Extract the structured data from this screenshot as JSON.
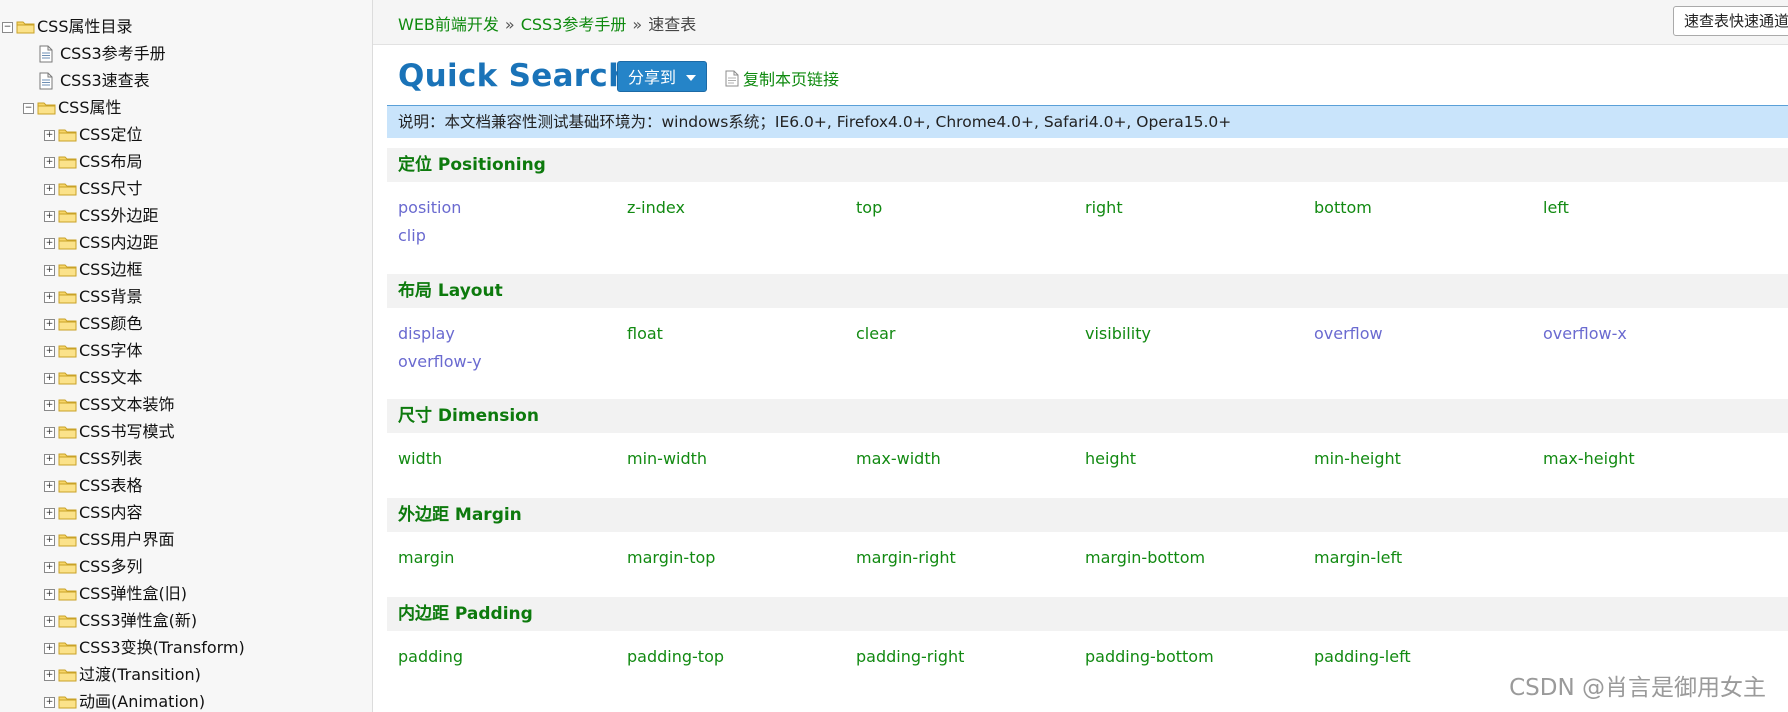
{
  "tree": {
    "root": "CSS属性目录",
    "docs": [
      "CSS3参考手册",
      "CSS3速查表"
    ],
    "group": "CSS属性",
    "children": [
      "CSS定位",
      "CSS布局",
      "CSS尺寸",
      "CSS外边距",
      "CSS内边距",
      "CSS边框",
      "CSS背景",
      "CSS颜色",
      "CSS字体",
      "CSS文本",
      "CSS文本装饰",
      "CSS书写模式",
      "CSS列表",
      "CSS表格",
      "CSS内容",
      "CSS用户界面",
      "CSS多列",
      "CSS弹性盒(旧)",
      "CSS3弹性盒(新)",
      "CSS3变换(Transform)",
      "过渡(Transition)",
      "动画(Animation)"
    ]
  },
  "breadcrumb": {
    "items": [
      "WEB前端开发",
      "CSS3参考手册",
      "速查表"
    ],
    "separator": "»"
  },
  "quick_access": "速查表快速通道",
  "page_title": "Quick Search",
  "share_label": "分享到",
  "copy_link_label": "复制本页链接",
  "notice": "说明：本文档兼容性测试基础环境为：windows系统；IE6.0+, Firefox4.0+, Chrome4.0+, Safari4.0+, Opera15.0+",
  "sections": [
    {
      "title": "定位 Positioning",
      "props": [
        {
          "name": "position",
          "color": "purple"
        },
        {
          "name": "z-index",
          "color": "green"
        },
        {
          "name": "top",
          "color": "green"
        },
        {
          "name": "right",
          "color": "green"
        },
        {
          "name": "bottom",
          "color": "green"
        },
        {
          "name": "left",
          "color": "green"
        },
        {
          "name": "clip",
          "color": "purple"
        }
      ]
    },
    {
      "title": "布局 Layout",
      "props": [
        {
          "name": "display",
          "color": "purple"
        },
        {
          "name": "float",
          "color": "green"
        },
        {
          "name": "clear",
          "color": "green"
        },
        {
          "name": "visibility",
          "color": "green"
        },
        {
          "name": "overflow",
          "color": "purple"
        },
        {
          "name": "overflow-x",
          "color": "purple"
        },
        {
          "name": "overflow-y",
          "color": "purple"
        }
      ]
    },
    {
      "title": "尺寸 Dimension",
      "props": [
        {
          "name": "width",
          "color": "green"
        },
        {
          "name": "min-width",
          "color": "green"
        },
        {
          "name": "max-width",
          "color": "green"
        },
        {
          "name": "height",
          "color": "green"
        },
        {
          "name": "min-height",
          "color": "green"
        },
        {
          "name": "max-height",
          "color": "green"
        }
      ]
    },
    {
      "title": "外边距 Margin",
      "props": [
        {
          "name": "margin",
          "color": "green"
        },
        {
          "name": "margin-top",
          "color": "green"
        },
        {
          "name": "margin-right",
          "color": "green"
        },
        {
          "name": "margin-bottom",
          "color": "green"
        },
        {
          "name": "margin-left",
          "color": "green"
        }
      ]
    },
    {
      "title": "内边距 Padding",
      "props": [
        {
          "name": "padding",
          "color": "green"
        },
        {
          "name": "padding-top",
          "color": "green"
        },
        {
          "name": "padding-right",
          "color": "green"
        },
        {
          "name": "padding-bottom",
          "color": "green"
        },
        {
          "name": "padding-left",
          "color": "green"
        }
      ]
    }
  ],
  "colors": {
    "link_green": "#128a12",
    "link_purple": "#6a6ad0",
    "title_blue": "#1a73b8",
    "notice_bg": "#c9e4fb"
  },
  "watermark": "CSDN @肖言是御用女主"
}
